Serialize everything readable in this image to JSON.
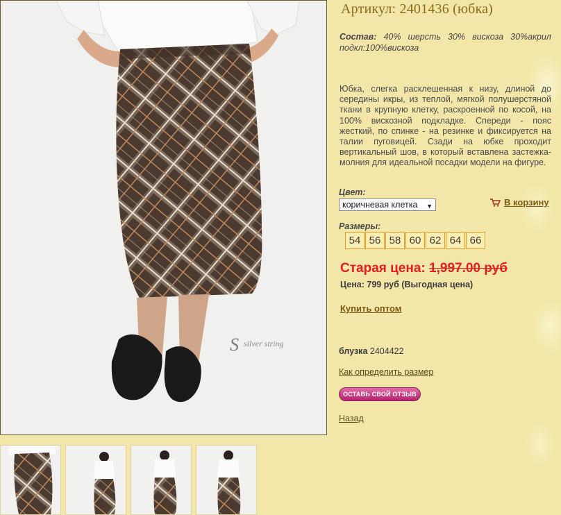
{
  "product": {
    "title": "Артикул: 2401436 (юбка)",
    "composition_label": "Состав:",
    "composition_value": "40% шерсть 30% вискоза 30%акрил подкл:100%вискоза",
    "description": "Юбка, слегка расклешенная к низу, длиной до середины икры, из теплой, мягкой полушерстяной ткани в крупную клетку, раскроенной по косой, на 100% вискозной подкладке. Спереди - пояс жесткий, по спинке - на резинке и фиксируется на талии пуговицей. Сзади на юбке проходит вертикальный шов, в который вставлена застежка-молния для идеальной посадки модели на фигуре."
  },
  "color": {
    "label": "Цвет:",
    "selected": "коричневая клетка"
  },
  "cart": {
    "label": "В корзину",
    "icon": "cart-icon"
  },
  "sizes": {
    "label": "Размеры:",
    "values": [
      "54",
      "56",
      "58",
      "60",
      "62",
      "64",
      "66"
    ]
  },
  "pricing": {
    "old_label": "Старая цена:",
    "old_value": "1,997.00 руб",
    "current": "Цена: 799 руб (Выгодная цена)"
  },
  "links": {
    "wholesale": "Купить оптом",
    "size_guide": "Как определить размер",
    "back": "Назад"
  },
  "related": {
    "label": "блузка",
    "value": "2404422"
  },
  "review_button": "ОСТАВЬ СВОЙ ОТЗЫВ",
  "watermark": "silver string",
  "colors": {
    "background": "#f2e7a8",
    "title": "#8a6a18",
    "old_price": "#e41e1e",
    "size_border": "#e39a2a",
    "link": "#7a5a10"
  }
}
